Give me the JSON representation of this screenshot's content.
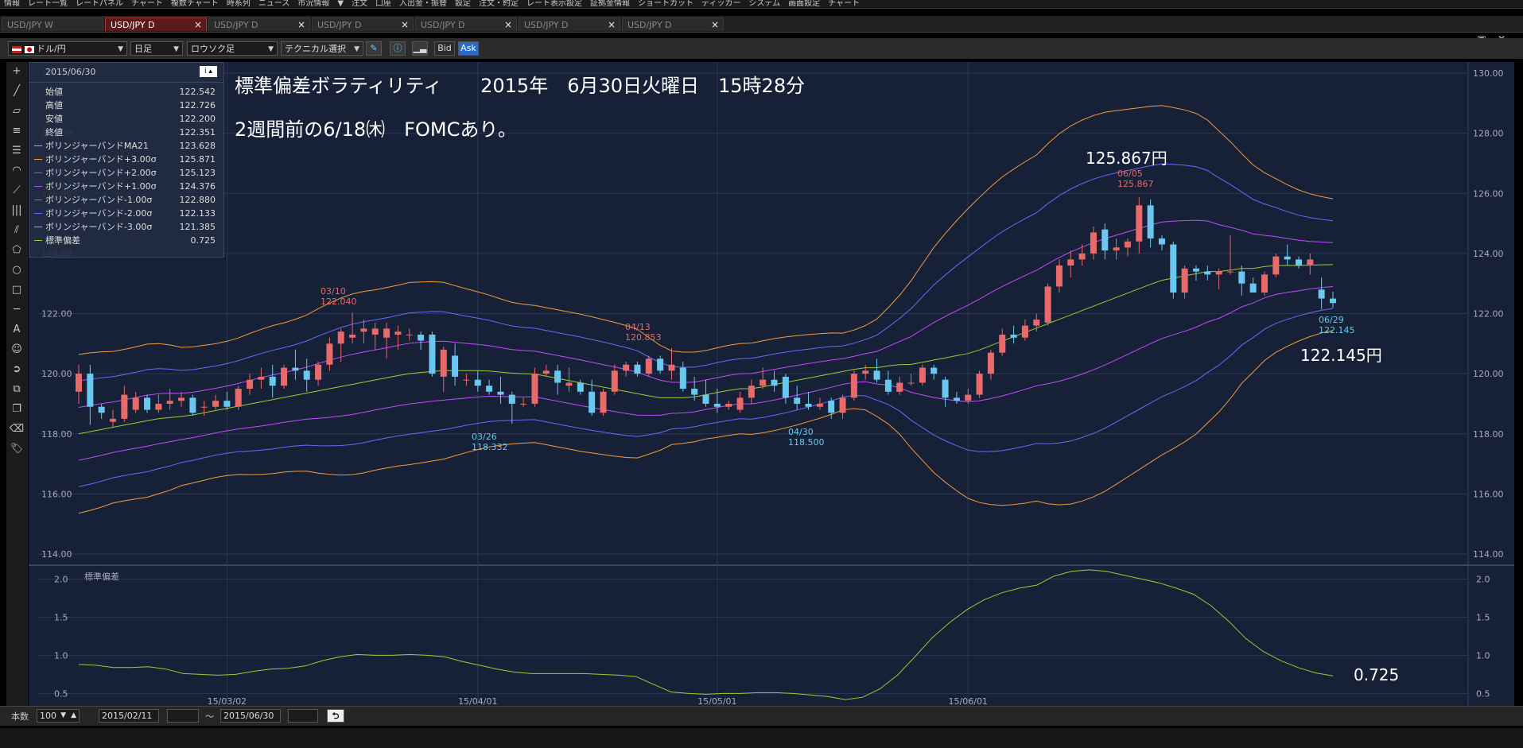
{
  "menu": [
    "情報",
    "レート一覧",
    "レートパネル",
    "チャート",
    "複数チャート",
    "時系列",
    "ニュース",
    "市況情報",
    "▼",
    "注文",
    "口座",
    "入出金・振替",
    "設定",
    "注文・約定",
    "レート表示設定",
    "証拠金情報",
    "ショートカット",
    "ティッカー",
    "システム",
    "画面設定",
    "チャート"
  ],
  "tabs": [
    {
      "label": "USD/JPY W",
      "active": false,
      "close": ""
    },
    {
      "label": "USD/JPY D",
      "active": true,
      "close": "×"
    },
    {
      "label": "USD/JPY D",
      "active": false,
      "close": "×"
    },
    {
      "label": "USD/JPY D",
      "active": false,
      "close": "×"
    },
    {
      "label": "USD/JPY D",
      "active": false,
      "close": "×"
    },
    {
      "label": "USD/JPY D",
      "active": false,
      "close": "×"
    },
    {
      "label": "USD/JPY D",
      "active": false,
      "close": "×"
    }
  ],
  "toolbar": {
    "currency": "ドル/円",
    "period": "日足",
    "chart_type": "ロウソク足",
    "technical": "テクニカル選択",
    "bid": "Bid",
    "ask": "Ask"
  },
  "info": {
    "date": "2015/06/30",
    "rows": [
      {
        "label": "始値",
        "value": "122.542",
        "color": ""
      },
      {
        "label": "高値",
        "value": "122.726",
        "color": ""
      },
      {
        "label": "安値",
        "value": "122.200",
        "color": ""
      },
      {
        "label": "終値",
        "value": "122.351",
        "color": ""
      },
      {
        "label": "ボリンジャーバンドMA21",
        "value": "123.628",
        "color": "#9acd32"
      },
      {
        "label": "ボリンジャーバンド+3.00σ",
        "value": "125.871",
        "color": "#f39c3a"
      },
      {
        "label": "ボリンジャーバンド+2.00σ",
        "value": "125.123",
        "color": "#6a6aff"
      },
      {
        "label": "ボリンジャーバンド+1.00σ",
        "value": "124.376",
        "color": "#c04cff"
      },
      {
        "label": "ボリンジャーバンド-1.00σ",
        "value": "122.880",
        "color": "#c04cff"
      },
      {
        "label": "ボリンジャーバンド-2.00σ",
        "value": "122.133",
        "color": "#6a6aff"
      },
      {
        "label": "ボリンジャーバンド-3.00σ",
        "value": "121.385",
        "color": "#f39c3a"
      },
      {
        "label": "標準偏差",
        "value": "0.725",
        "color": "#9acd32"
      }
    ]
  },
  "annotations": {
    "title": "標準偏差ボラティリティ　　2015年　6月30日火曜日　15時28分",
    "note": "2週間前の6/18㈭　FOMCあり。",
    "high_price": "125.867円",
    "last_price": "122.145円",
    "sd_value": "0.725"
  },
  "chart_data": [
    {
      "type": "candlestick",
      "title": "USD/JPY D",
      "x_tick_labels": [
        "15/03/02",
        "15/04/01",
        "15/05/01",
        "15/06/01"
      ],
      "y_ticks": [
        114.0,
        116.0,
        118.0,
        120.0,
        122.0,
        124.0,
        126.0,
        128.0,
        130.0
      ],
      "ylim": [
        114.0,
        130.0
      ],
      "grid": true,
      "candles": [
        [
          119.4,
          120.3,
          119.0,
          120.0
        ],
        [
          120.0,
          120.3,
          118.3,
          118.9
        ],
        [
          118.9,
          119.0,
          118.5,
          118.7
        ],
        [
          118.4,
          118.8,
          118.2,
          118.5
        ],
        [
          118.5,
          119.6,
          118.4,
          119.3
        ],
        [
          118.8,
          119.4,
          118.7,
          119.2
        ],
        [
          119.2,
          119.3,
          118.7,
          118.8
        ],
        [
          118.8,
          119.3,
          118.7,
          119.0
        ],
        [
          119.0,
          119.5,
          118.8,
          119.1
        ],
        [
          119.1,
          119.4,
          118.9,
          119.2
        ],
        [
          119.2,
          119.3,
          118.6,
          118.7
        ],
        [
          118.9,
          119.1,
          118.6,
          118.9
        ],
        [
          118.9,
          119.3,
          118.8,
          119.1
        ],
        [
          119.1,
          119.4,
          118.8,
          118.9
        ],
        [
          118.9,
          119.6,
          118.8,
          119.5
        ],
        [
          119.5,
          120.0,
          119.3,
          119.8
        ],
        [
          119.8,
          120.2,
          119.5,
          119.9
        ],
        [
          119.9,
          120.3,
          119.2,
          119.6
        ],
        [
          119.6,
          120.3,
          119.5,
          120.2
        ],
        [
          120.2,
          120.8,
          119.8,
          120.1
        ],
        [
          120.1,
          120.5,
          119.4,
          119.8
        ],
        [
          119.8,
          120.4,
          119.6,
          120.3
        ],
        [
          120.3,
          121.2,
          120.1,
          121.0
        ],
        [
          121.0,
          121.5,
          120.4,
          121.4
        ],
        [
          121.2,
          122.04,
          121.0,
          121.3
        ],
        [
          121.4,
          121.8,
          121.0,
          121.5
        ],
        [
          121.3,
          121.7,
          120.8,
          121.5
        ],
        [
          121.2,
          121.7,
          120.5,
          121.5
        ],
        [
          121.3,
          121.6,
          120.8,
          121.4
        ],
        [
          121.3,
          121.5,
          121.1,
          121.3
        ],
        [
          121.3,
          121.4,
          120.8,
          121.1
        ],
        [
          121.3,
          121.4,
          119.9,
          120.0
        ],
        [
          119.9,
          120.9,
          119.4,
          120.8
        ],
        [
          120.6,
          121.0,
          119.6,
          119.9
        ],
        [
          119.8,
          120.0,
          119.6,
          119.8
        ],
        [
          119.8,
          120.1,
          119.4,
          119.6
        ],
        [
          119.6,
          119.8,
          119.3,
          119.4
        ],
        [
          119.4,
          119.9,
          119.0,
          119.3
        ],
        [
          119.3,
          119.4,
          118.33,
          119.0
        ],
        [
          119.0,
          119.2,
          118.9,
          119.0
        ],
        [
          119.0,
          120.2,
          118.9,
          120.0
        ],
        [
          120.0,
          120.3,
          119.9,
          120.1
        ],
        [
          120.1,
          120.3,
          119.3,
          119.7
        ],
        [
          119.6,
          120.2,
          119.4,
          119.7
        ],
        [
          119.7,
          119.8,
          119.3,
          119.4
        ],
        [
          119.4,
          119.8,
          118.6,
          118.7
        ],
        [
          118.7,
          119.5,
          118.6,
          119.4
        ],
        [
          119.4,
          120.3,
          119.3,
          120.1
        ],
        [
          120.1,
          120.4,
          119.9,
          120.3
        ],
        [
          120.3,
          120.4,
          119.9,
          120.0
        ],
        [
          120.0,
          120.6,
          119.9,
          120.5
        ],
        [
          120.5,
          120.6,
          120.0,
          120.1
        ],
        [
          120.1,
          120.85,
          119.8,
          120.3
        ],
        [
          120.2,
          120.4,
          119.4,
          119.5
        ],
        [
          119.5,
          119.9,
          119.1,
          119.3
        ],
        [
          119.3,
          119.8,
          118.9,
          119.0
        ],
        [
          119.0,
          119.5,
          118.7,
          118.9
        ],
        [
          118.9,
          119.1,
          118.8,
          119.0
        ],
        [
          118.8,
          119.4,
          118.7,
          119.2
        ],
        [
          119.2,
          119.8,
          119.0,
          119.6
        ],
        [
          119.6,
          120.2,
          119.5,
          119.8
        ],
        [
          119.8,
          120.1,
          119.4,
          119.6
        ],
        [
          119.9,
          120.0,
          119.0,
          119.2
        ],
        [
          119.2,
          119.6,
          118.8,
          119.0
        ],
        [
          119.0,
          119.4,
          118.8,
          118.9
        ],
        [
          118.9,
          119.2,
          118.8,
          119.0
        ],
        [
          119.1,
          119.2,
          118.5,
          118.7
        ],
        [
          118.7,
          119.3,
          118.5,
          119.2
        ],
        [
          119.2,
          120.1,
          119.1,
          120.0
        ],
        [
          120.0,
          120.3,
          119.8,
          120.1
        ],
        [
          120.1,
          120.5,
          119.7,
          119.8
        ],
        [
          119.8,
          120.1,
          119.3,
          119.4
        ],
        [
          119.4,
          119.9,
          119.3,
          119.7
        ],
        [
          119.7,
          120.0,
          119.6,
          119.7
        ],
        [
          119.7,
          120.3,
          119.6,
          120.2
        ],
        [
          120.2,
          120.3,
          119.8,
          120.0
        ],
        [
          119.8,
          119.9,
          118.9,
          119.2
        ],
        [
          119.2,
          119.4,
          119.0,
          119.1
        ],
        [
          119.1,
          119.5,
          119.0,
          119.3
        ],
        [
          119.3,
          120.1,
          119.2,
          120.0
        ],
        [
          120.0,
          120.8,
          119.8,
          120.7
        ],
        [
          120.7,
          121.5,
          120.6,
          121.3
        ],
        [
          121.3,
          121.6,
          121.0,
          121.2
        ],
        [
          121.2,
          121.8,
          121.1,
          121.6
        ],
        [
          121.6,
          122.0,
          121.4,
          121.8
        ],
        [
          121.7,
          123.0,
          121.6,
          122.9
        ],
        [
          122.9,
          123.8,
          122.7,
          123.6
        ],
        [
          123.6,
          124.1,
          123.2,
          123.8
        ],
        [
          123.8,
          124.3,
          123.6,
          124.0
        ],
        [
          124.0,
          124.9,
          123.8,
          124.7
        ],
        [
          124.8,
          125.0,
          123.8,
          124.1
        ],
        [
          124.1,
          124.5,
          123.8,
          124.2
        ],
        [
          124.2,
          124.5,
          123.9,
          124.4
        ],
        [
          124.4,
          125.867,
          124.0,
          125.6
        ],
        [
          125.6,
          125.8,
          124.2,
          124.5
        ],
        [
          124.5,
          124.6,
          124.1,
          124.3
        ],
        [
          124.3,
          124.4,
          122.5,
          122.7
        ],
        [
          122.7,
          123.6,
          122.5,
          123.5
        ],
        [
          123.5,
          123.6,
          123.1,
          123.4
        ],
        [
          123.4,
          123.6,
          123.1,
          123.3
        ],
        [
          123.3,
          123.5,
          122.8,
          123.4
        ],
        [
          123.4,
          124.6,
          123.3,
          123.4
        ],
        [
          123.4,
          123.6,
          122.6,
          123.0
        ],
        [
          123.0,
          123.2,
          122.7,
          122.7
        ],
        [
          122.7,
          123.4,
          122.6,
          123.3
        ],
        [
          123.3,
          124.0,
          123.2,
          123.9
        ],
        [
          123.9,
          124.3,
          123.6,
          123.8
        ],
        [
          123.8,
          123.9,
          123.5,
          123.6
        ],
        [
          123.6,
          124.0,
          123.3,
          123.8
        ],
        [
          122.8,
          123.2,
          122.145,
          122.5
        ],
        [
          122.5,
          122.73,
          122.2,
          122.35
        ]
      ],
      "bands": {
        "ma21": [
          118.0,
          118.1,
          118.2,
          118.3,
          118.4,
          118.5,
          118.55,
          118.6,
          118.7,
          118.8,
          118.9,
          119.0,
          119.1,
          119.2,
          119.3,
          119.4,
          119.5,
          119.6,
          119.7,
          119.8,
          119.9,
          120.0,
          120.05,
          120.1,
          120.1,
          120.1,
          120.1,
          120.05,
          120.0,
          120.0,
          119.9,
          119.8,
          119.7,
          119.6,
          119.5,
          119.4,
          119.3,
          119.2,
          119.2,
          119.2,
          119.3,
          119.4,
          119.5,
          119.5,
          119.6,
          119.7,
          119.8,
          119.9,
          120.0,
          120.1,
          120.2,
          120.2,
          120.3,
          120.3,
          120.4,
          120.5,
          120.6,
          120.7,
          120.9,
          121.1,
          121.3,
          121.5,
          121.7,
          121.9,
          122.1,
          122.3,
          122.5,
          122.7,
          122.9,
          123.1,
          123.2,
          123.3,
          123.4,
          123.4,
          123.5,
          123.5,
          123.6,
          123.6,
          123.6,
          123.62,
          123.63
        ]
      },
      "labels": {
        "h1": "03/10",
        "h1v": "122.040",
        "l1": "03/26",
        "l1v": "118.332",
        "h2": "04/13",
        "h2v": "120.853",
        "l2": "04/30",
        "l2v": "118.500",
        "h3": "06/05",
        "h3v": "125.867",
        "l3": "06/29",
        "l3v": "122.145"
      }
    },
    {
      "type": "line",
      "title": "標準偏差",
      "y_ticks": [
        0.5,
        1.0,
        1.5,
        2.0
      ],
      "ylim": [
        0.4,
        2.15
      ],
      "values": [
        0.88,
        0.87,
        0.84,
        0.84,
        0.85,
        0.82,
        0.76,
        0.75,
        0.74,
        0.75,
        0.79,
        0.82,
        0.83,
        0.86,
        0.93,
        0.98,
        1.01,
        1.0,
        1.0,
        1.01,
        1.0,
        0.98,
        0.92,
        0.87,
        0.82,
        0.78,
        0.76,
        0.76,
        0.76,
        0.76,
        0.75,
        0.74,
        0.72,
        0.62,
        0.52,
        0.5,
        0.49,
        0.5,
        0.5,
        0.51,
        0.51,
        0.5,
        0.48,
        0.46,
        0.42,
        0.45,
        0.56,
        0.74,
        0.98,
        1.23,
        1.43,
        1.6,
        1.73,
        1.82,
        1.88,
        1.92,
        2.04,
        2.1,
        2.12,
        2.1,
        2.05,
        2.0,
        1.95,
        1.88,
        1.8,
        1.65,
        1.45,
        1.22,
        1.05,
        0.93,
        0.84,
        0.77,
        0.73
      ],
      "series": [
        {
          "name": "標準偏差"
        }
      ]
    }
  ],
  "bottom": {
    "count_label": "本数",
    "count": "100",
    "date_from": "2015/02/11",
    "tilde": "～",
    "date_to": "2015/06/30",
    "sd_label": "標準偏差"
  }
}
